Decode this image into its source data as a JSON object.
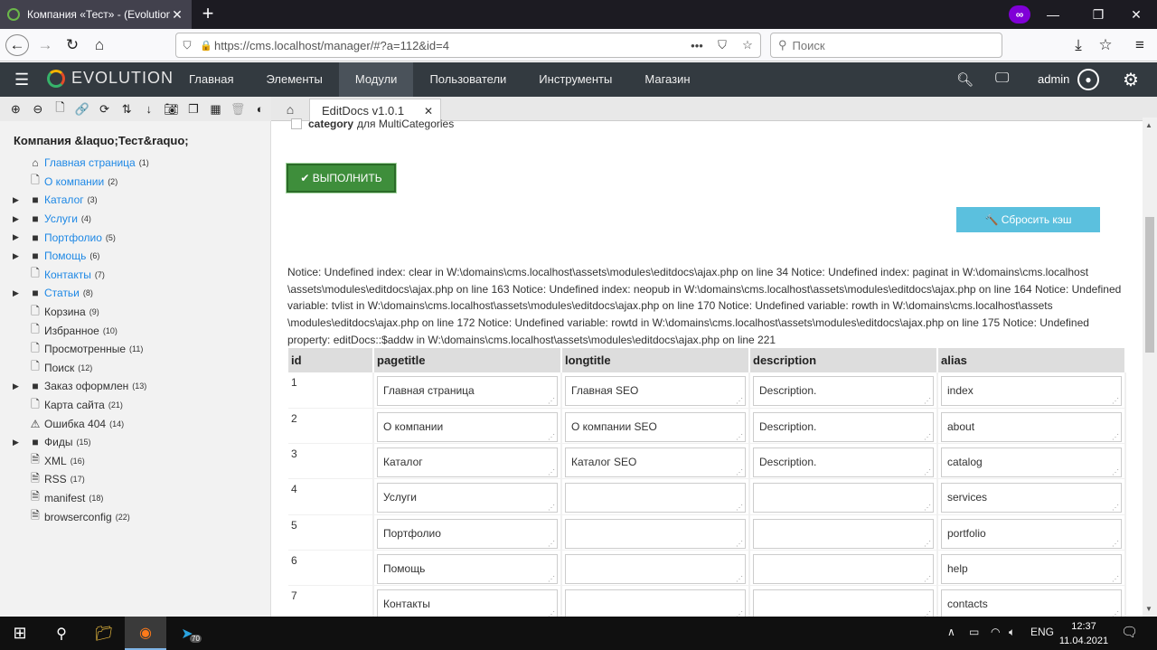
{
  "browser": {
    "tab_title": "Компания «Тест» - (Evolution",
    "tab_close": "✕",
    "new_tab": "+",
    "private_badge": "∞",
    "win_minimize": "—",
    "win_maximize": "❐",
    "win_close": "✕",
    "url": "https://cms.localhost/manager/#?a=112&id=4",
    "url_actions": "•••",
    "search_placeholder": "Поиск"
  },
  "topnav": {
    "brand": "EVOLUTION",
    "menu": [
      "Главная",
      "Элементы",
      "Модули",
      "Пользователи",
      "Инструменты",
      "Магазин"
    ],
    "active_index": 2,
    "user": "admin"
  },
  "sidebar": {
    "site_name": "Компания &laquo;Тест&raquo;",
    "tree": [
      {
        "label": "Главная страница",
        "count": "(1)",
        "icon": "home-icon",
        "expandable": false,
        "style": "link"
      },
      {
        "label": "О компании",
        "count": "(2)",
        "icon": "document-icon",
        "expandable": false,
        "style": "link"
      },
      {
        "label": "Каталог",
        "count": "(3)",
        "icon": "folder-icon",
        "expandable": true,
        "style": "link"
      },
      {
        "label": "Услуги",
        "count": "(4)",
        "icon": "folder-icon",
        "expandable": true,
        "style": "link"
      },
      {
        "label": "Портфолио",
        "count": "(5)",
        "icon": "folder-icon",
        "expandable": true,
        "style": "link"
      },
      {
        "label": "Помощь",
        "count": "(6)",
        "icon": "folder-icon",
        "expandable": true,
        "style": "link"
      },
      {
        "label": "Контакты",
        "count": "(7)",
        "icon": "document-icon",
        "expandable": false,
        "style": "link"
      },
      {
        "label": "Статьи",
        "count": "(8)",
        "icon": "folder-icon",
        "expandable": true,
        "style": "link"
      },
      {
        "label": "Корзина",
        "count": "(9)",
        "icon": "document-icon",
        "expandable": false,
        "style": "plain"
      },
      {
        "label": "Избранное",
        "count": "(10)",
        "icon": "document-icon",
        "expandable": false,
        "style": "plain"
      },
      {
        "label": "Просмотренные",
        "count": "(11)",
        "icon": "document-icon",
        "expandable": false,
        "style": "plain"
      },
      {
        "label": "Поиск",
        "count": "(12)",
        "icon": "document-icon",
        "expandable": false,
        "style": "plain"
      },
      {
        "label": "Заказ оформлен",
        "count": "(13)",
        "icon": "folder-icon",
        "expandable": true,
        "style": "plain"
      },
      {
        "label": "Карта сайта",
        "count": "(21)",
        "icon": "document-icon",
        "expandable": false,
        "style": "plain"
      },
      {
        "label": "Ошибка 404",
        "count": "(14)",
        "icon": "warning-icon",
        "expandable": false,
        "style": "plain"
      },
      {
        "label": "Фиды",
        "count": "(15)",
        "icon": "folder-icon",
        "expandable": true,
        "style": "plain"
      },
      {
        "label": "XML",
        "count": "(16)",
        "icon": "code-file-icon",
        "expandable": false,
        "style": "plain"
      },
      {
        "label": "RSS",
        "count": "(17)",
        "icon": "code-file-icon",
        "expandable": false,
        "style": "plain"
      },
      {
        "label": "manifest",
        "count": "(18)",
        "icon": "code-file-icon",
        "expandable": false,
        "style": "plain"
      },
      {
        "label": "browserconfig",
        "count": "(22)",
        "icon": "code-file-icon",
        "expandable": false,
        "style": "plain"
      }
    ]
  },
  "content": {
    "tab_label": "EditDocs v1.0.1",
    "tab_close": "✕",
    "checkbox_bold": "category",
    "checkbox_text": "для MultiCategories",
    "run_button": "✔ ВЫПОЛНИТЬ",
    "cache_button": "🔨 Сбросить кэш",
    "notice": "Notice: Undefined index: clear in W:\\domains\\cms.localhost\\assets\\modules\\editdocs\\ajax.php on line 34 Notice: Undefined index: paginat in W:\\domains\\cms.localhost \\assets\\modules\\editdocs\\ajax.php on line 163 Notice: Undefined index: neopub in W:\\domains\\cms.localhost\\assets\\modules\\editdocs\\ajax.php on line 164 Notice: Undefined variable: tvlist in W:\\domains\\cms.localhost\\assets\\modules\\editdocs\\ajax.php on line 170 Notice: Undefined variable: rowth in W:\\domains\\cms.localhost\\assets \\modules\\editdocs\\ajax.php on line 172 Notice: Undefined variable: rowtd in W:\\domains\\cms.localhost\\assets\\modules\\editdocs\\ajax.php on line 175 Notice: Undefined property: editDocs::$addw in W:\\domains\\cms.localhost\\assets\\modules\\editdocs\\ajax.php on line 221",
    "columns": [
      "id",
      "pagetitle",
      "longtitle",
      "description",
      "alias"
    ],
    "rows": [
      {
        "id": "1",
        "pagetitle": "Главная страница",
        "longtitle": "Главная SEO",
        "description": "Description.",
        "alias": "index"
      },
      {
        "id": "2",
        "pagetitle": "О компании",
        "longtitle": "О компании SEO",
        "description": "Description.",
        "alias": "about"
      },
      {
        "id": "3",
        "pagetitle": "Каталог",
        "longtitle": "Каталог SEO",
        "description": "Description.",
        "alias": "catalog"
      },
      {
        "id": "4",
        "pagetitle": "Услуги",
        "longtitle": "",
        "description": "",
        "alias": "services"
      },
      {
        "id": "5",
        "pagetitle": "Портфолио",
        "longtitle": "",
        "description": "",
        "alias": "portfolio"
      },
      {
        "id": "6",
        "pagetitle": "Помощь",
        "longtitle": "",
        "description": "",
        "alias": "help"
      },
      {
        "id": "7",
        "pagetitle": "Контакты",
        "longtitle": "",
        "description": "",
        "alias": "contacts"
      }
    ]
  },
  "taskbar": {
    "telegram_badge": "70",
    "language": "ENG",
    "time": "12:37",
    "date": "11.04.2021"
  },
  "colors": {
    "topnav_bg": "#333a40",
    "run_button": "#3e8e3b",
    "cache_button": "#5bc0de",
    "link": "#1e88e5"
  }
}
